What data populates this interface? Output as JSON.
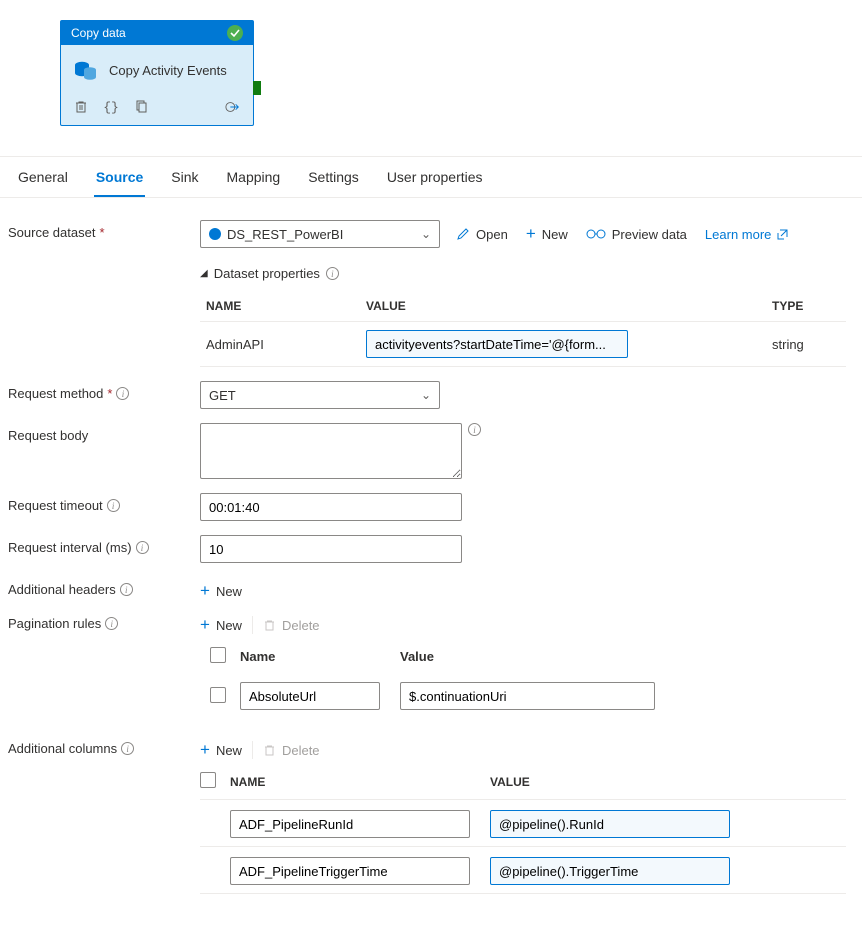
{
  "activity": {
    "header": "Copy data",
    "title": "Copy Activity Events"
  },
  "tabs": [
    "General",
    "Source",
    "Sink",
    "Mapping",
    "Settings",
    "User properties"
  ],
  "active_tab": "Source",
  "labels": {
    "source_dataset": "Source dataset",
    "dataset_properties": "Dataset properties",
    "request_method": "Request method",
    "request_body": "Request body",
    "request_timeout": "Request timeout",
    "request_interval": "Request interval (ms)",
    "additional_headers": "Additional headers",
    "pagination_rules": "Pagination rules",
    "additional_columns": "Additional columns"
  },
  "source_dataset": {
    "value": "DS_REST_PowerBI",
    "actions": {
      "open": "Open",
      "new": "New",
      "preview": "Preview data",
      "learn": "Learn more"
    }
  },
  "dataset_properties": {
    "cols": {
      "name": "NAME",
      "value": "VALUE",
      "type": "TYPE"
    },
    "rows": [
      {
        "name": "AdminAPI",
        "value": "activityevents?startDateTime='@{form...",
        "type": "string"
      }
    ]
  },
  "request_method": "GET",
  "request_body": "",
  "request_timeout": "00:01:40",
  "request_interval": "10",
  "buttons": {
    "new": "New",
    "delete": "Delete"
  },
  "pagination": {
    "cols": {
      "name": "Name",
      "value": "Value"
    },
    "rows": [
      {
        "name": "AbsoluteUrl",
        "value": "$.continuationUri"
      }
    ]
  },
  "additional_columns": {
    "cols": {
      "name": "NAME",
      "value": "VALUE"
    },
    "rows": [
      {
        "name": "ADF_PipelineRunId",
        "value": "@pipeline().RunId"
      },
      {
        "name": "ADF_PipelineTriggerTime",
        "value": "@pipeline().TriggerTime"
      }
    ]
  }
}
